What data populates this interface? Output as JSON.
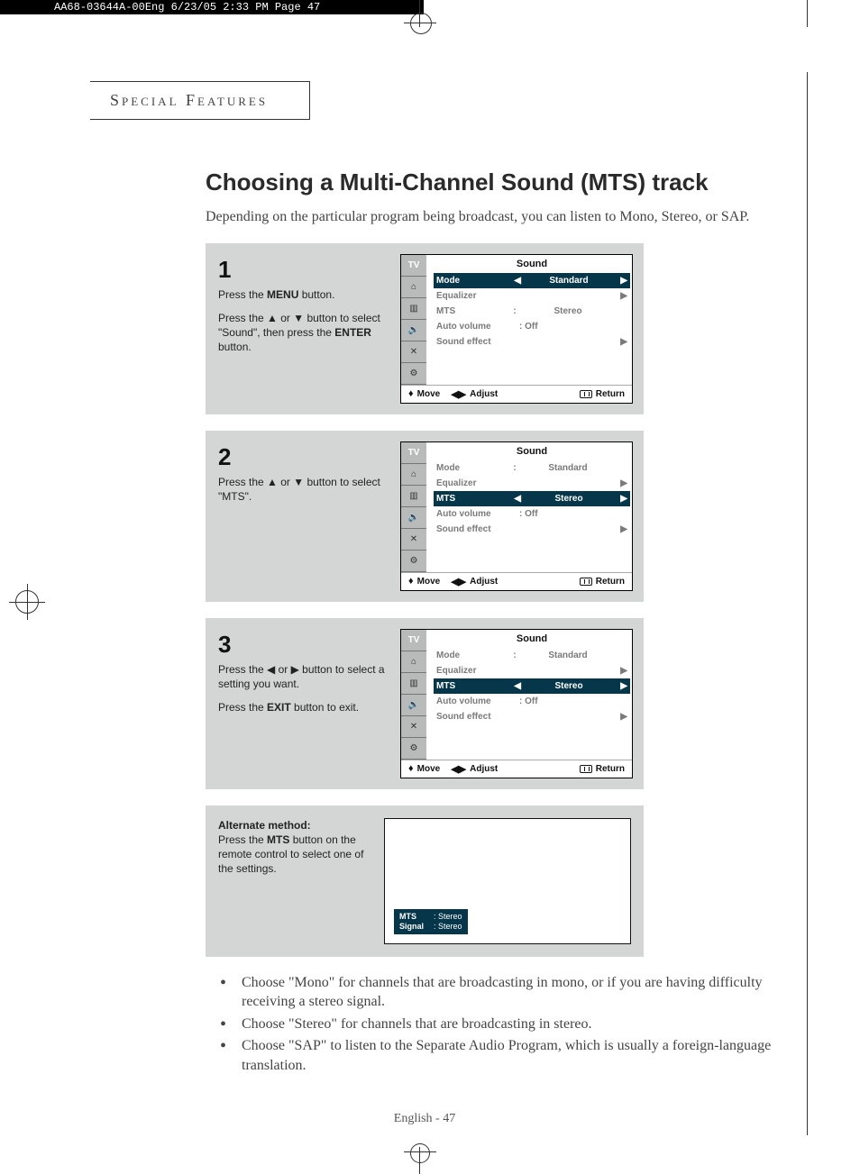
{
  "crop_label": "AA68-03644A-00Eng  6/23/05  2:33 PM  Page 47",
  "section_header": "Special Features",
  "title": "Choosing a Multi-Channel Sound (MTS) track",
  "intro": "Depending on the particular program being broadcast, you can listen to Mono, Stereo, or SAP.",
  "steps": {
    "s1": {
      "num": "1",
      "p1a": "Press the ",
      "p1b": "MENU",
      "p1c": " button.",
      "p2a": "Press the ▲ or ▼ button to select \"Sound\", then press the ",
      "p2b": "ENTER",
      "p2c": " button.",
      "selected": "Mode"
    },
    "s2": {
      "num": "2",
      "p1": "Press the ▲ or ▼ button to select \"MTS\".",
      "selected": "MTS"
    },
    "s3": {
      "num": "3",
      "p1": "Press the ◀ or ▶ button to select a setting you want.",
      "p2a": "Press the ",
      "p2b": "EXIT",
      "p2c": " button to exit.",
      "selected": "MTS"
    }
  },
  "menu": {
    "title": "Sound",
    "rows": {
      "mode": {
        "label": "Mode",
        "colon": ":",
        "value": "Standard",
        "arrowL": "◀",
        "arrowR": "▶"
      },
      "eq": {
        "label": "Equalizer",
        "colon": "",
        "value": "",
        "arrowL": "",
        "arrowR": "▶"
      },
      "mts": {
        "label": "MTS",
        "colon": ":",
        "value": "Stereo",
        "arrowL": "◀",
        "arrowR": "▶"
      },
      "av": {
        "label": "Auto volume",
        "colon": "",
        "value": ": Off",
        "arrowL": "",
        "arrowR": ""
      },
      "se": {
        "label": "Sound effect",
        "colon": "",
        "value": "",
        "arrowL": "",
        "arrowR": "▶"
      }
    },
    "footer": {
      "move": "Move",
      "adjust": "Adjust",
      "return": "Return"
    },
    "icons": {
      "tv": "TV"
    }
  },
  "alt": {
    "title": "Alternate method:",
    "body_a": "Press the ",
    "body_b": "MTS",
    "body_c": " button on the remote control to select one of the settings.",
    "osd": {
      "r1k": "MTS",
      "r1v": ": Stereo",
      "r2k": "Signal",
      "r2v": ": Stereo"
    }
  },
  "bullets": {
    "b1": "Choose \"Mono\" for channels that are broadcasting in mono, or if you are having difficulty receiving a stereo signal.",
    "b2": "Choose \"Stereo\" for channels that are broadcasting in stereo.",
    "b3": "Choose \"SAP\" to listen to the Separate Audio Program, which is usually a foreign-language translation."
  },
  "page_footer": "English - 47"
}
